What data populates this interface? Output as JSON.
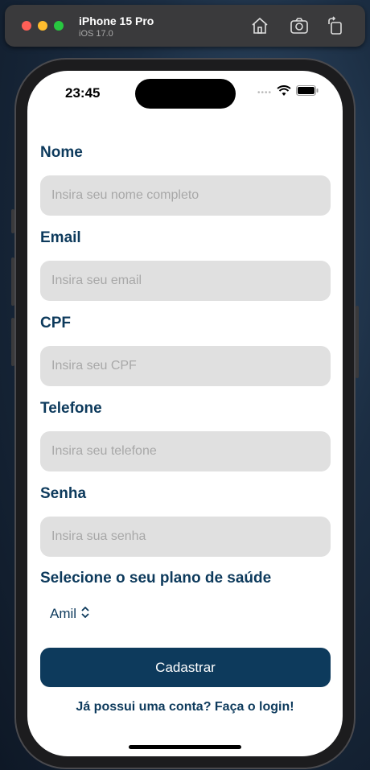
{
  "simulator": {
    "device_name": "iPhone 15 Pro",
    "os_version": "iOS 17.0",
    "icons": [
      "home-icon",
      "screenshot-icon",
      "rotate-icon"
    ]
  },
  "status_bar": {
    "time": "23:45",
    "signal_dots": "•••• ",
    "icons": [
      "wifi-icon",
      "battery-icon"
    ]
  },
  "form": {
    "fields": [
      {
        "label": "Nome",
        "placeholder": "Insira seu nome completo"
      },
      {
        "label": "Email",
        "placeholder": "Insira seu email"
      },
      {
        "label": "CPF",
        "placeholder": "Insira seu CPF"
      },
      {
        "label": "Telefone",
        "placeholder": "Insira seu telefone"
      },
      {
        "label": "Senha",
        "placeholder": "Insira sua senha"
      }
    ],
    "plan_label": "Selecione o seu plano de saúde",
    "plan_selected": "Amil",
    "submit_label": "Cadastrar",
    "login_link": "Já possui uma conta? Faça o login!"
  },
  "colors": {
    "primary": "#0d3a5c",
    "input_bg": "#e0e0e0",
    "placeholder": "#a8a8a8"
  }
}
